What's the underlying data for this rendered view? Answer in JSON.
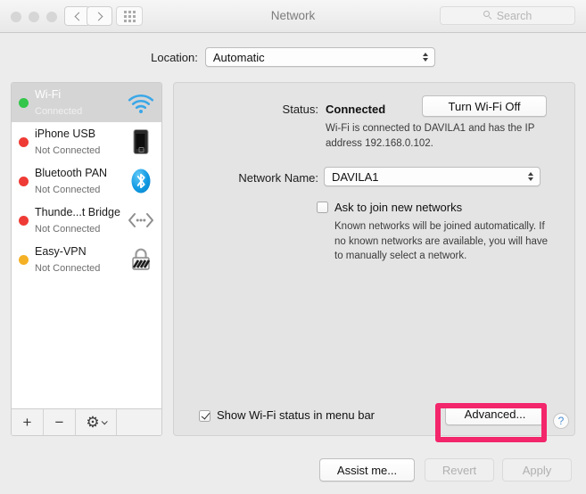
{
  "window": {
    "title": "Network",
    "traffic_lights": [
      "close",
      "minimize",
      "zoom"
    ]
  },
  "toolbar": {
    "back_icon": "chevron-left-icon",
    "forward_icon": "chevron-right-icon",
    "grid_icon": "show-all-grid-icon",
    "search": {
      "placeholder": "Search",
      "value": "",
      "icon": "search-icon"
    }
  },
  "location": {
    "label": "Location:",
    "value": "Automatic",
    "options": [
      "Automatic"
    ]
  },
  "sidebar": {
    "items": [
      {
        "name": "Wi-Fi",
        "status": "Connected",
        "dot_color": "#33c64a",
        "icon": "wifi-icon",
        "selected": true
      },
      {
        "name": "iPhone USB",
        "status": "Not Connected",
        "dot_color": "#ef3b35",
        "icon": "iphone-icon",
        "selected": false
      },
      {
        "name": "Bluetooth PAN",
        "status": "Not Connected",
        "dot_color": "#ef3b35",
        "icon": "bluetooth-icon",
        "selected": false
      },
      {
        "name": "Thunde...t Bridge",
        "status": "Not Connected",
        "dot_color": "#ef3b35",
        "icon": "thunderbolt-bridge-icon",
        "selected": false
      },
      {
        "name": "Easy-VPN",
        "status": "Not Connected",
        "dot_color": "#f5b125",
        "icon": "vpn-lock-icon",
        "selected": false
      }
    ],
    "toolbar": {
      "add_label": "+",
      "remove_label": "−",
      "gear_icon": "gear-icon",
      "gear_chevron_icon": "chevron-down-icon"
    }
  },
  "main": {
    "status_label": "Status:",
    "status_value": "Connected",
    "status_description": "Wi-Fi is connected to DAVILA1 and has the IP address 192.168.0.102.",
    "turn_wifi_off_label": "Turn Wi-Fi Off",
    "network_name_label": "Network Name:",
    "network_name_value": "DAVILA1",
    "network_name_options": [
      "DAVILA1"
    ],
    "ask_to_join": {
      "label": "Ask to join new networks",
      "checked": false,
      "description": "Known networks will be joined automatically. If no known networks are available, you will have to manually select a network."
    },
    "show_status_menu_bar": {
      "label": "Show Wi-Fi status in menu bar",
      "checked": true
    },
    "advanced_label": "Advanced...",
    "help_label": "?"
  },
  "footer": {
    "assist_label": "Assist me...",
    "revert_label": "Revert",
    "revert_disabled": true,
    "apply_label": "Apply",
    "apply_disabled": true
  },
  "annotation": {
    "highlight_color": "#f3256b",
    "highlight_target": "Advanced..."
  }
}
